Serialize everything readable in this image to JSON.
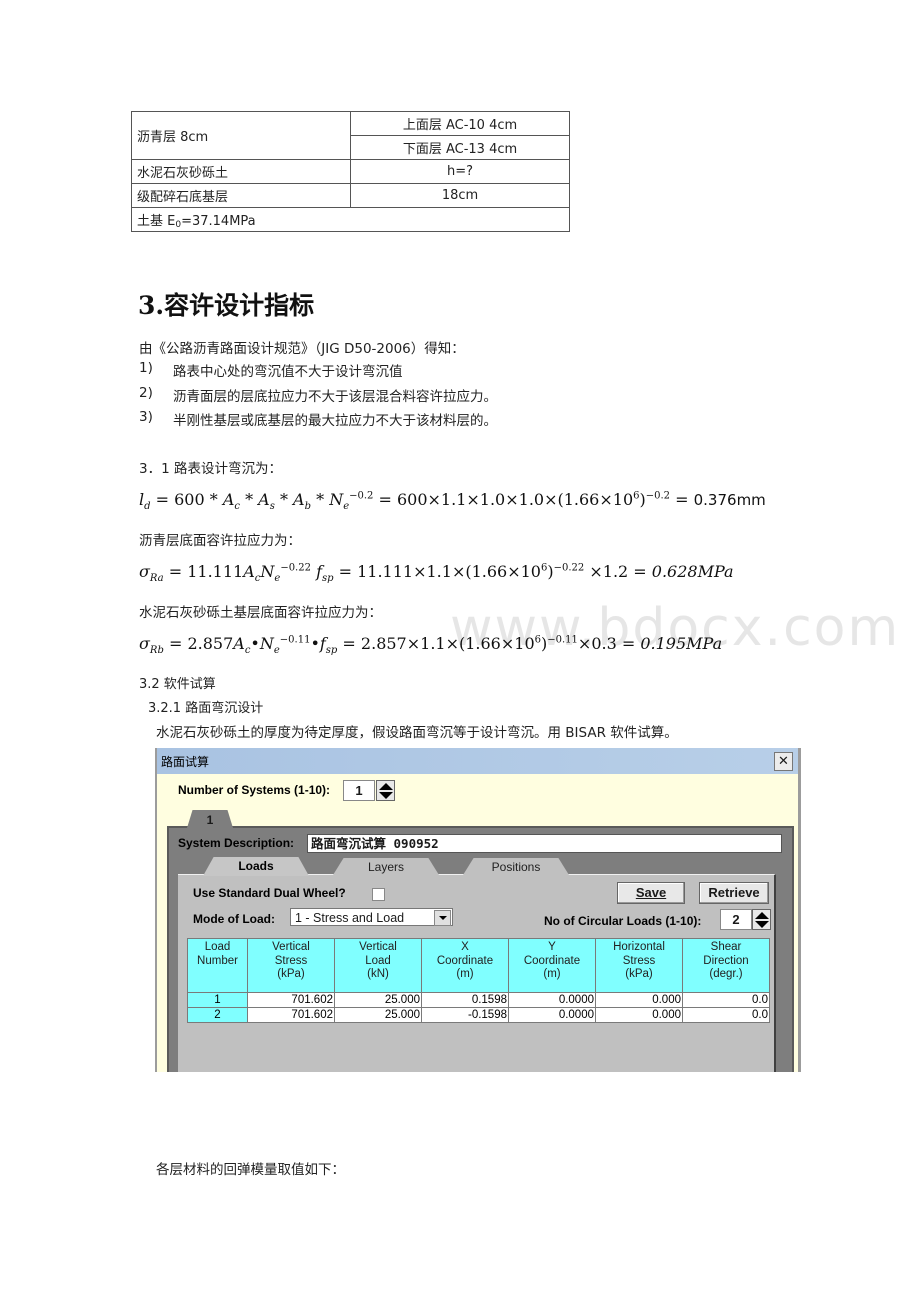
{
  "layer_table": {
    "rows": [
      {
        "name": "沥青层 8cm",
        "sub": [
          "上面层 AC-10 4cm",
          "下面层  AC-13 4cm"
        ]
      },
      {
        "name": "水泥石灰砂砾土",
        "value": "h=?"
      },
      {
        "name": "级配碎石底基层",
        "value": "18cm"
      }
    ],
    "subgrade": {
      "prefix": "土基 E",
      "sub": "0",
      "suffix": "=37.14MPa"
    }
  },
  "section": {
    "heading": "3.容许设计指标",
    "intro": "由《公路沥青路面设计规范》（JIG D50-2006）得知：",
    "criteria": [
      {
        "num": "1)",
        "text": "路表中心处的弯沉值不大于设计弯沉值"
      },
      {
        "num": "2)",
        "text": "沥青面层的层底拉应力不大于该层混合料容许拉应力。"
      },
      {
        "num": "3)",
        "text": "半刚性基层或底基层的最大拉应力不大于该材料层的。"
      }
    ],
    "deflection_label": "3．1 路表设计弯沉为：",
    "formula_ld": {
      "lhs": "l",
      "lhs_sub": "d",
      "expr": " = 600 * A_c * A_s * A_b * N_e^−0.2 = 600×1.1×1.0×1.0×(1.66×10^6)^−0.2 = ",
      "result": "0.376mm"
    },
    "asphalt_label": "沥青层底面容许拉应力为：",
    "formula_ra": {
      "lhs_sub": "Ra",
      "result": "0.628MPa"
    },
    "cement_label": "水泥石灰砂砾土基层底面容许拉应力为：",
    "formula_rb": {
      "lhs_sub": "Rb",
      "result": "0.195MPa"
    },
    "software_heading": "3.2 软件试算",
    "subsection_heading": "3.2.1 路面弯沉设计",
    "software_text": "水泥石灰砂砾土的厚度为待定厚度，假设路面弯沉等于设计弯沉。用 BISAR 软件试算。",
    "footer_text": "各层材料的回弹模量取值如下："
  },
  "watermark": "www.bdocx.com",
  "dialog": {
    "title": "路面试算",
    "close_label": "✕",
    "num_systems_label": "Number of Systems (1-10):",
    "num_systems_value": "1",
    "system_tab": "1",
    "system_desc_label": "System Description:",
    "system_desc_value": "路面弯沉试算 090952",
    "tabs": [
      {
        "label": "Loads",
        "active": true
      },
      {
        "label": "Layers",
        "active": false
      },
      {
        "label": "Positions",
        "active": false
      }
    ],
    "dual_wheel_label": "Use Standard Dual Wheel?",
    "dual_wheel_checked": false,
    "save_label": "Save",
    "retrieve_label": "Retrieve",
    "mode_label": "Mode of Load:",
    "mode_value": "1 - Stress and Load",
    "circular_loads_label": "No of Circular Loads (1-10):",
    "circular_loads_value": "2",
    "grid": {
      "headers": [
        [
          "Load",
          "Number"
        ],
        [
          "Vertical",
          "Stress",
          "(kPa)"
        ],
        [
          "Vertical",
          "Load",
          "(kN)"
        ],
        [
          "X",
          "Coordinate",
          "(m)"
        ],
        [
          "Y",
          "Coordinate",
          "(m)"
        ],
        [
          "Horizontal",
          "Stress",
          "(kPa)"
        ],
        [
          "Shear",
          "Direction",
          "(degr.)"
        ]
      ],
      "rows": [
        [
          "1",
          "701.602",
          "25.000",
          "0.1598",
          "0.0000",
          "0.000",
          "0.0"
        ],
        [
          "2",
          "701.602",
          "25.000",
          "-0.1598",
          "0.0000",
          "0.000",
          "0.0"
        ]
      ]
    }
  },
  "colors": {
    "grid_header": "#80ffff",
    "dialog_bg": "#fffee0",
    "titlebar": "#a9c3e2"
  }
}
